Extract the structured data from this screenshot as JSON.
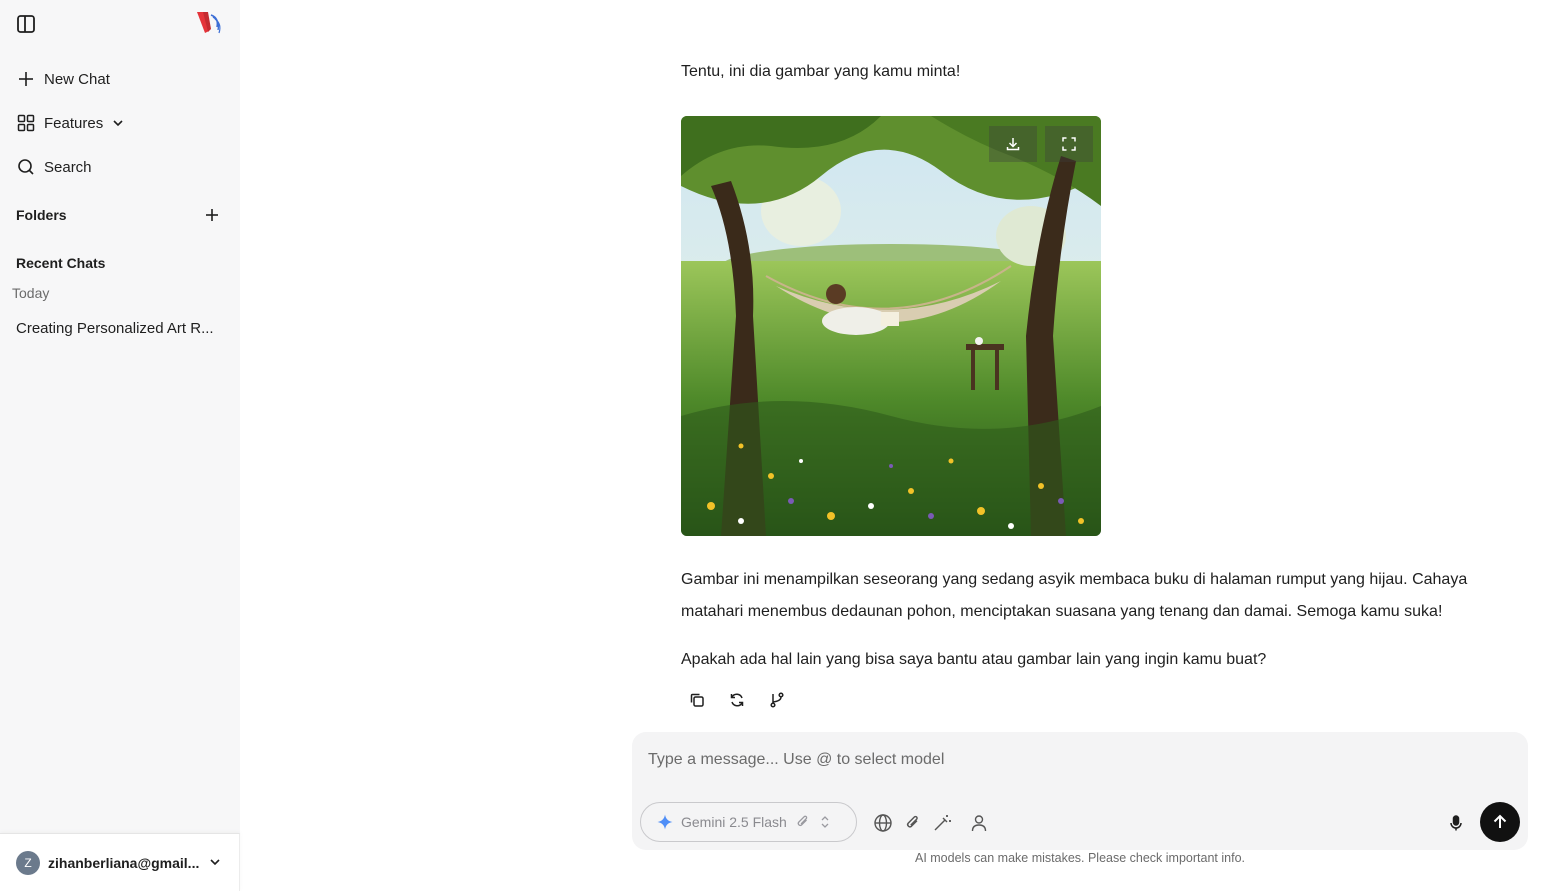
{
  "sidebar": {
    "new_chat": "New Chat",
    "features": "Features",
    "search": "Search",
    "folders_title": "Folders",
    "recent_title": "Recent Chats",
    "today_label": "Today",
    "chats": [
      "Creating Personalized Art R..."
    ],
    "user": {
      "initial": "Z",
      "email": "zihanberliana@gmail..."
    }
  },
  "conversation": {
    "intro": "Tentu, ini dia gambar yang kamu minta!",
    "description_line1": "Gambar ini menampilkan seseorang yang sedang asyik membaca buku di halaman rumput yang hijau. Cahaya",
    "description_line2": "matahari menembus dedaunan pohon, menciptakan suasana yang tenang dan damai. Semoga kamu suka!",
    "followup": "Apakah ada hal lain yang bisa saya bantu atau gambar lain yang ingin kamu buat?"
  },
  "composer": {
    "placeholder": "Type a message... Use @ to select model",
    "model": "Gemini 2.5 Flash",
    "disclaimer": "AI models can make mistakes. Please check important info."
  },
  "colors": {
    "accent": "#111111",
    "logo_red": "#e4343a",
    "logo_blue": "#3d6fd6",
    "sparkle": "#4f8ef7"
  }
}
